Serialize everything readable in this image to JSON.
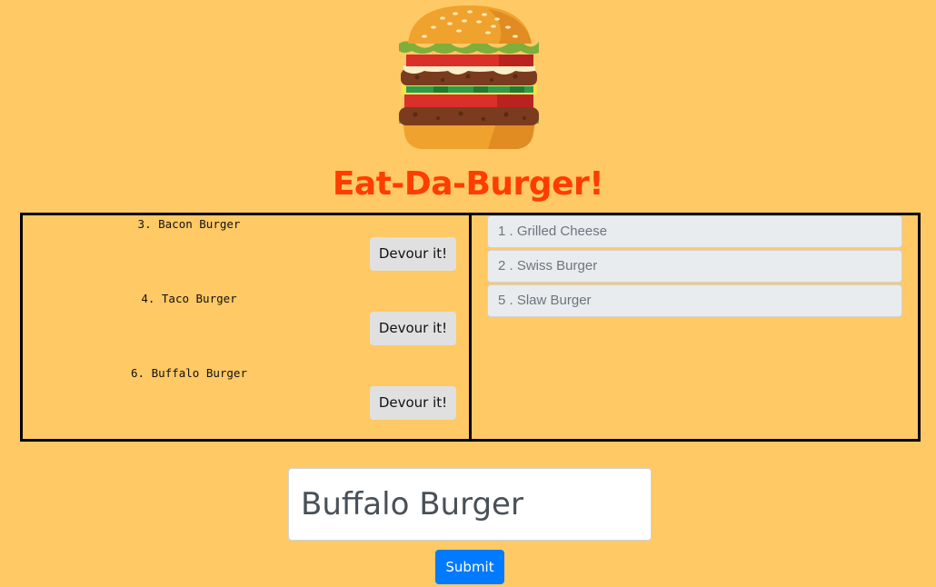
{
  "header": {
    "logo_icon": "burger-icon",
    "title": "Eat-Da-Burger!",
    "title_color": "#ff3d00"
  },
  "not_devoured": {
    "items": [
      {
        "name": "3. Bacon Burger",
        "button_label": "Devour it!"
      },
      {
        "name": "4. Taco Burger",
        "button_label": "Devour it!"
      },
      {
        "name": "6. Buffalo Burger",
        "button_label": "Devour it!"
      }
    ]
  },
  "devoured": {
    "items": [
      {
        "label": "1 . Grilled Cheese"
      },
      {
        "label": "2 . Swiss Burger"
      },
      {
        "label": "5 . Slaw Burger"
      }
    ]
  },
  "form": {
    "input_value": "Buffalo Burger",
    "submit_label": "Submit",
    "submit_color": "#007bff"
  },
  "colors": {
    "background": "#ffc965",
    "border": "#000000"
  }
}
